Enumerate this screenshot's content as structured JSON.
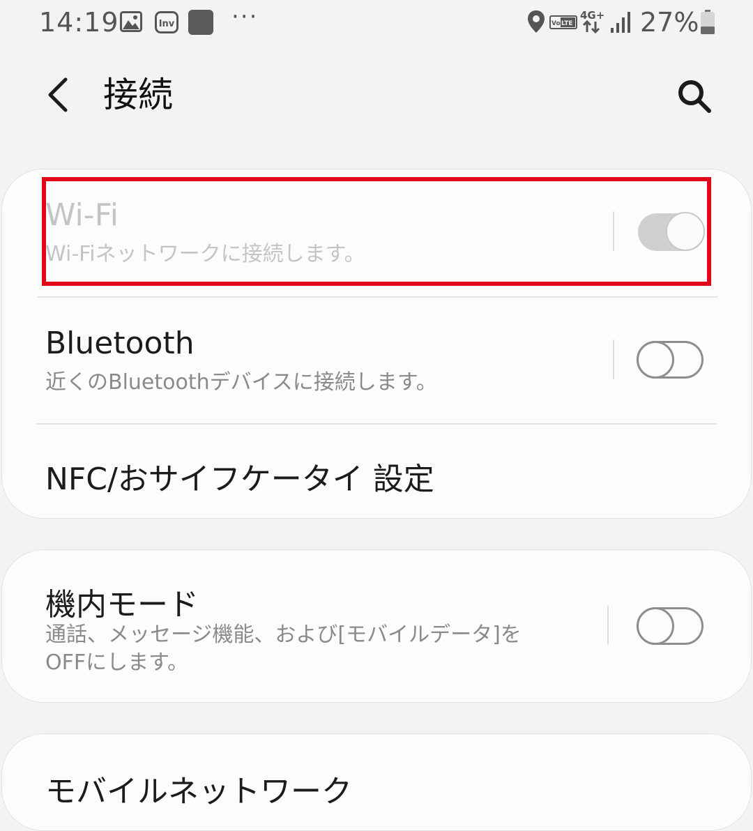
{
  "status_bar": {
    "time": "14:19",
    "more": "···",
    "volte": "VoLTE",
    "network": "4G+",
    "battery_percent": "27%",
    "icons": [
      "image-icon",
      "inv-app-icon",
      "app-notification-icon",
      "location-icon",
      "volte-icon",
      "network-4g-icon",
      "signal-icon",
      "battery-icon"
    ]
  },
  "app_bar": {
    "title": "接続",
    "back_icon": "chevron-left-icon",
    "search_icon": "search-icon"
  },
  "settings": {
    "wifi": {
      "title": "Wi-Fi",
      "subtitle": "Wi-Fiネットワークに接続します。",
      "toggle_state": "on",
      "enabled": false
    },
    "bluetooth": {
      "title": "Bluetooth",
      "subtitle": "近くのBluetoothデバイスに接続します。",
      "toggle_state": "off"
    },
    "nfc": {
      "title": "NFC/おサイフケータイ 設定"
    },
    "airplane": {
      "title": "機内モード",
      "subtitle_line1": "通話、メッセージ機能、および[モバイルデータ]を",
      "subtitle_line2": "OFFにします。",
      "toggle_state": "off"
    },
    "mobile_network": {
      "title": "モバイルネットワーク"
    }
  },
  "colors": {
    "background": "#f3f3f3",
    "card": "#fcfcfc",
    "highlight": "#e3061a",
    "subtitle": "#8a8a8a",
    "disabled_text": "#c4c4c4"
  }
}
